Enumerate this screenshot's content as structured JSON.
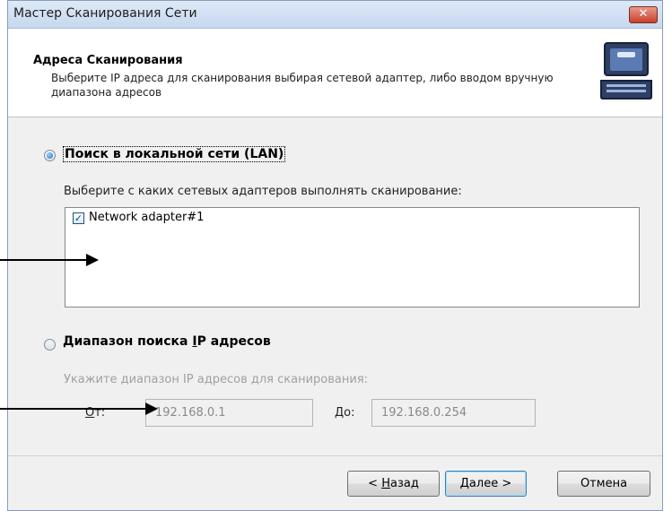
{
  "window": {
    "title": "Мастер Сканирования Сети",
    "close_glyph": "✕"
  },
  "header": {
    "title": "Адреса Сканирования",
    "subtitle": "Выберите IP адреса для сканирования выбирая сетевой адаптер, либо вводом вручную диапазона адресов",
    "icon": "laptop-icon"
  },
  "lan": {
    "label": "Поиск в локальной сети (LAN)",
    "selected": true,
    "prompt": "Выберите с каких сетевых адаптеров выполнять сканирование:",
    "adapters": [
      {
        "label": "Network adapter#1",
        "checked": true
      }
    ]
  },
  "range": {
    "label_before": "Диапазон поиска ",
    "label_underlined": "I",
    "label_after": "P адресов",
    "selected": false,
    "prompt": "Укажите диапазон IP адресов для сканирования:",
    "from_label_underlined": "О",
    "from_label_rest": "т:",
    "from_value": "192.168.0.1",
    "to_label_underlined": "Д",
    "to_label_rest": "о:",
    "to_value": "192.168.0.254"
  },
  "buttons": {
    "back_prefix": "< ",
    "back_underlined": "Н",
    "back_rest": "азад",
    "next_underlined": "Д",
    "next_rest": "алее >",
    "cancel": "Отмена"
  },
  "colors": {
    "accent": "#1c6fc6",
    "window_bg": "#f0f0f0"
  }
}
